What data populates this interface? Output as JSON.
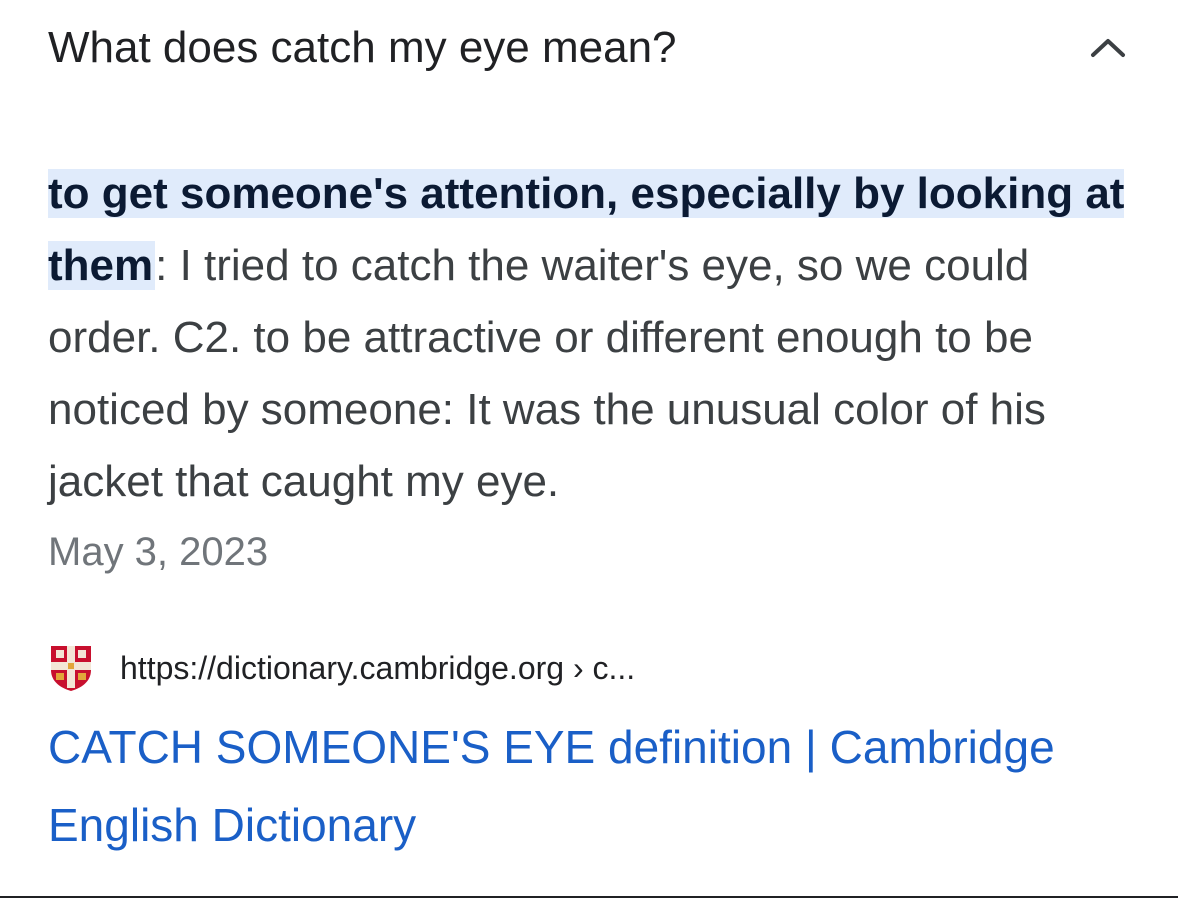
{
  "accordion": {
    "question": "What does catch my eye mean?",
    "toggle_icon": "chevron-up-icon",
    "expanded": true
  },
  "answer": {
    "highlighted": "to get someone's attention, especially by looking at them",
    "body": ": I tried to catch the waiter's eye, so we could order. C2. to be attractive or different enough to be noticed by someone: It was the unusual color of his jacket that caught my eye.",
    "date": "May 3, 2023"
  },
  "source": {
    "favicon": "cambridge-shield-icon",
    "url": "https://dictionary.cambridge.org › c...",
    "title": "CATCH SOMEONE'S EYE definition | Cambridge English Dictionary"
  },
  "colors": {
    "link": "#1a5fc7",
    "highlight": "#e0ebfb",
    "muted": "#70757a"
  }
}
